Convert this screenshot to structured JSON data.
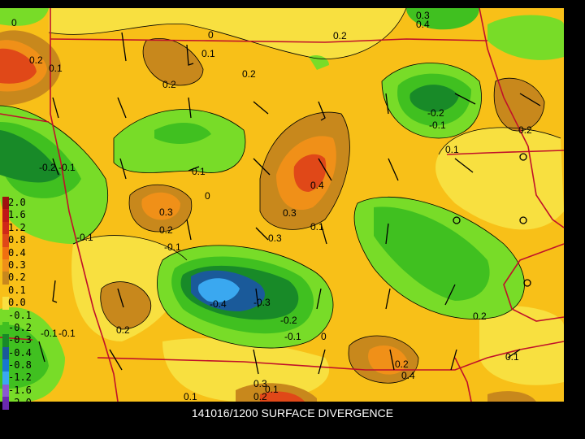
{
  "caption": "141016/1200 SURFACE DIVERGENCE",
  "legend": [
    {
      "label": "2.0",
      "color": "#a01010"
    },
    {
      "label": "1.6",
      "color": "#c01818"
    },
    {
      "label": "1.2",
      "color": "#d02818"
    },
    {
      "label": "0.8",
      "color": "#e04818"
    },
    {
      "label": "0.4",
      "color": "#f07010"
    },
    {
      "label": "0.3",
      "color": "#f09018"
    },
    {
      "label": "0.2",
      "color": "#c8881c"
    },
    {
      "label": "0.1",
      "color": "#f8c018"
    },
    {
      "label": "0.0",
      "color": "#f8e040"
    },
    {
      "label": "-0.1",
      "color": "#78dc28"
    },
    {
      "label": "-0.2",
      "color": "#40c020"
    },
    {
      "label": "-0.3",
      "color": "#188a28"
    },
    {
      "label": "-0.4",
      "color": "#1a5a9a"
    },
    {
      "label": "-0.8",
      "color": "#1878d0"
    },
    {
      "label": "-1.2",
      "color": "#3aa8f0"
    },
    {
      "label": "-1.6",
      "color": "#8a5ad0"
    },
    {
      "label": "-2.0",
      "color": "#6a2ab0"
    }
  ],
  "contour_labels": [
    "0",
    "0.2",
    "0.1",
    "0",
    "0.2",
    "0.1",
    "0.2",
    "0.2",
    "-0.2",
    "-0.1",
    "0.1",
    "0.4",
    "0.3",
    "0.2",
    "0.3",
    "0.2",
    "-0.1",
    "0",
    "-0.2",
    "-0.1",
    "0.1",
    "-0.4",
    "-0.3",
    "-0.2",
    "-0.1",
    "0",
    "0.3",
    "0.2",
    "-0.1",
    "0.1",
    "0.2",
    "0.4",
    "0.3",
    "0.1",
    "0.2",
    "-0.1",
    "-0.1",
    "0.1",
    "0.2",
    "0.1",
    "0.3",
    "0.4"
  ],
  "colors": {
    "state_border": "#c0102a",
    "barb": "#000000",
    "background": "#000000"
  }
}
